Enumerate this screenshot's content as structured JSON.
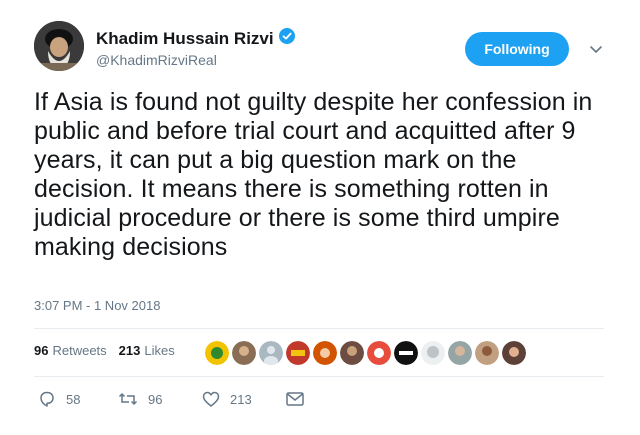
{
  "user": {
    "display_name": "Khadim Hussain Rizvi",
    "handle": "@KhadimRizviReal",
    "verified": true
  },
  "follow_button": {
    "label": "Following",
    "color": "#1da1f2"
  },
  "tweet": {
    "text": "If Asia is found not guilty despite her confession in public and before trial court and acquitted after 9 years, it can put a big question mark on the decision. It means there is something rotten in judicial procedure or there is some third umpire making decisions",
    "timestamp": "3:07 PM - 1 Nov 2018"
  },
  "stats": {
    "retweets_count": "96",
    "retweets_label": "Retweets",
    "likes_count": "213",
    "likes_label": "Likes"
  },
  "actions": {
    "reply_count": "58",
    "retweet_count": "96",
    "like_count": "213"
  },
  "colors": {
    "text": "#14171a",
    "muted": "#657786",
    "verified_badge": "#1da1f2"
  }
}
